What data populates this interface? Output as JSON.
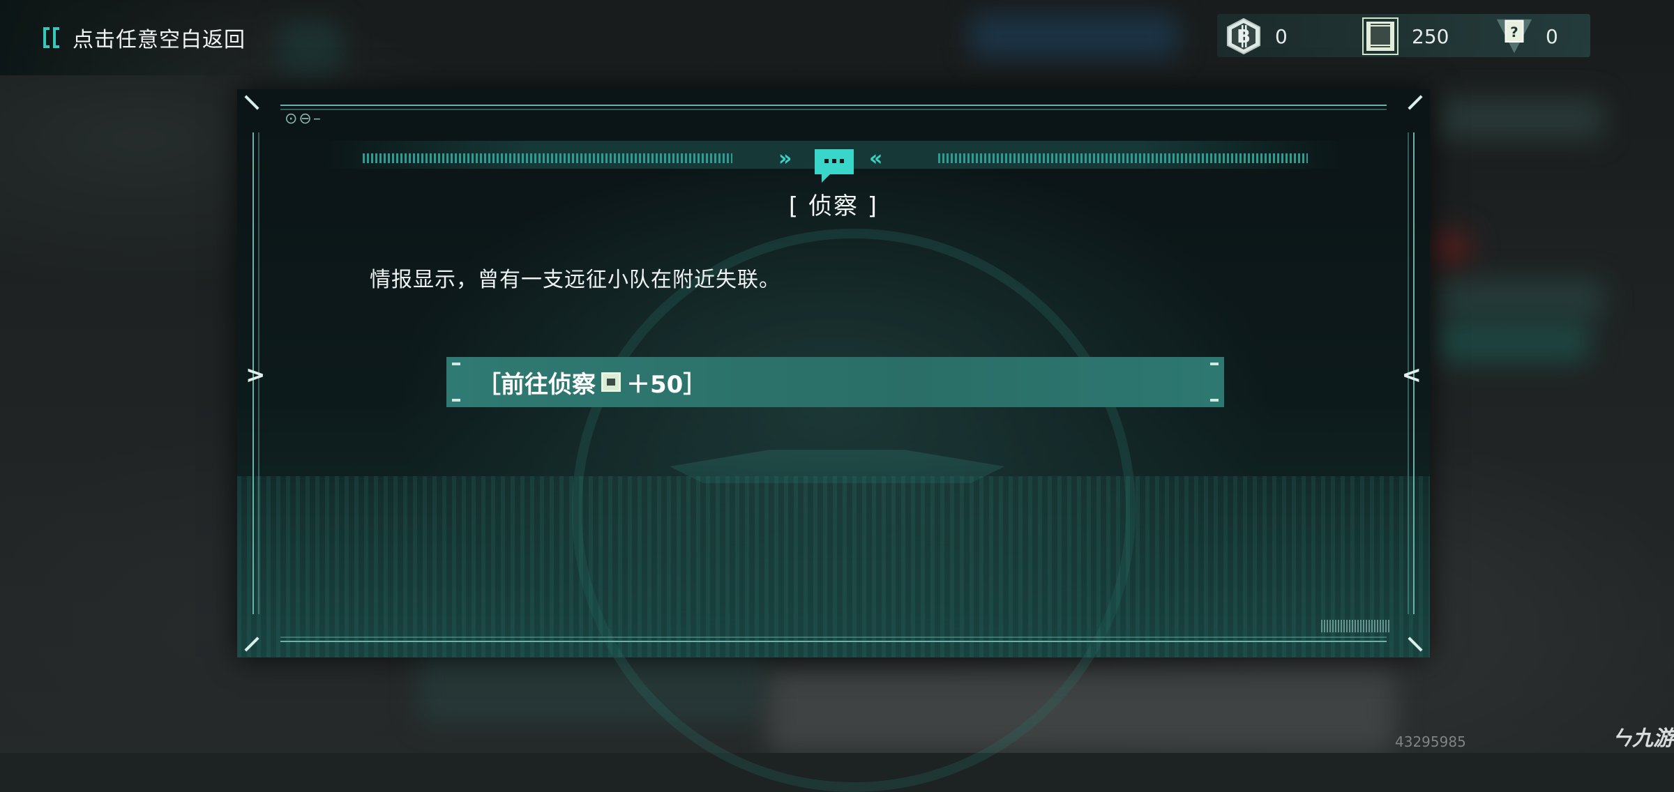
{
  "header": {
    "back_hint": "点击任意空白返回"
  },
  "currencies": [
    {
      "icon": "b-coin-icon",
      "value": "0"
    },
    {
      "icon": "intel-card-icon",
      "value": "250"
    },
    {
      "icon": "mystery-card-icon",
      "value": "0"
    }
  ],
  "dialog": {
    "title": "[ 侦察 ]",
    "body": "情报显示，曾有一支远征小队在附近失联。",
    "option": {
      "prefix": "［前往侦察",
      "icon": "intel-card-icon",
      "suffix": "＋50］"
    }
  },
  "watermark": {
    "number": "43295985",
    "logo": "九游"
  },
  "colors": {
    "accent": "#35c9bd",
    "option_bg": "#2f7a72",
    "panel_bg": "#0d1a1b"
  }
}
